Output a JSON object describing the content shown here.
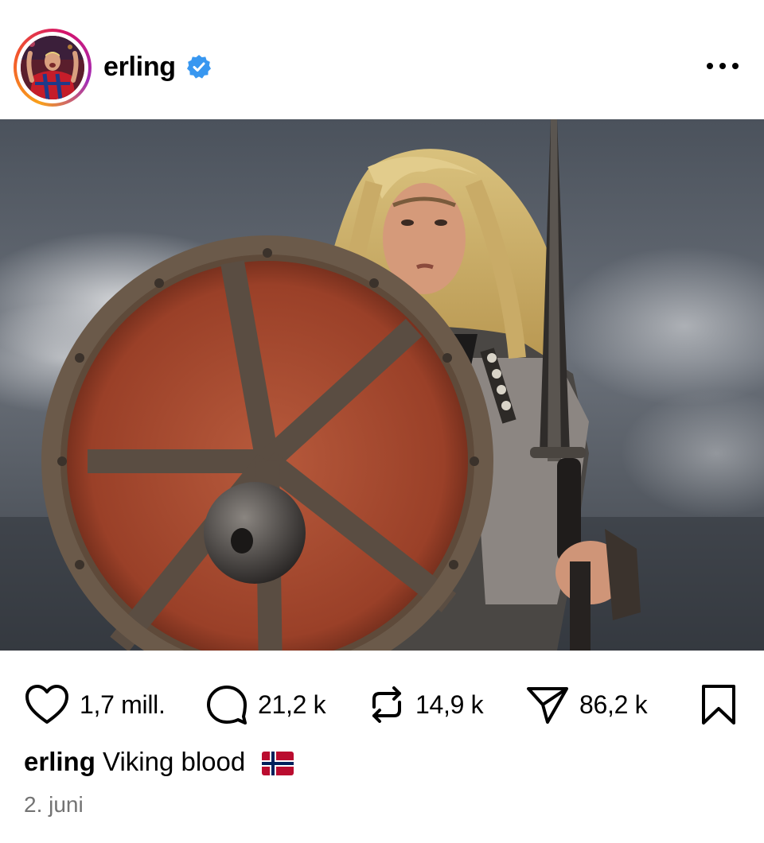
{
  "post": {
    "username": "erling",
    "verified": true,
    "avatar_icon": "profile-photo-player-icon",
    "more_icon": "more-options-icon",
    "photo_icon": "viking-portrait-photo",
    "caption_text": "Viking blood",
    "caption_emoji_icon": "norway-flag-icon",
    "date": "2. juni"
  },
  "actions": {
    "likes": "1,7 mill.",
    "comments": "21,2 k",
    "reposts": "14,9 k",
    "shares": "86,2 k",
    "icons": [
      "heart-icon",
      "comment-icon",
      "repost-icon",
      "share-icon",
      "bookmark-icon"
    ]
  },
  "colors": {
    "verified_blue": "#3897f0",
    "date_gray": "#737373"
  }
}
